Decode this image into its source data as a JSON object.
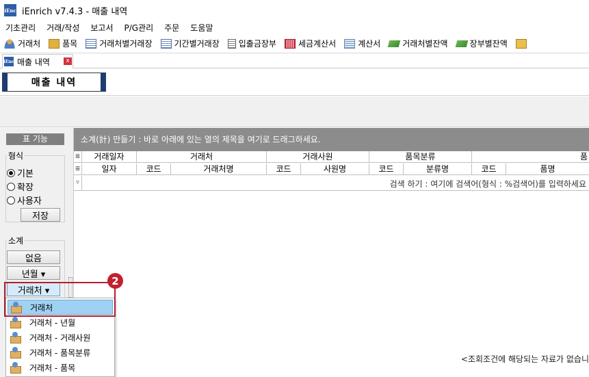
{
  "app": {
    "icon_text": "iEnc",
    "title": "iEnrich v7.4.3 - 매출 내역"
  },
  "menu": [
    "기초관리",
    "거래/작성",
    "보고서",
    "P/G관리",
    "주문",
    "도움말"
  ],
  "toolbar": [
    {
      "label": "거래처",
      "icon": "user-icon"
    },
    {
      "label": "품목",
      "icon": "box-icon"
    },
    {
      "label": "거래처별거래장",
      "icon": "list-icon"
    },
    {
      "label": "기간별거래장",
      "icon": "list-icon"
    },
    {
      "label": "입출금장부",
      "icon": "ledger-icon"
    },
    {
      "label": "세금계산서",
      "icon": "invoice-icon"
    },
    {
      "label": "계산서",
      "icon": "calc-icon"
    },
    {
      "label": "거래처별잔액",
      "icon": "money-icon"
    },
    {
      "label": "장부별잔액",
      "icon": "money-icon"
    }
  ],
  "tab": {
    "label": "매출 내역",
    "close": "x"
  },
  "banner": {
    "title": "매출 내역"
  },
  "left_panel": {
    "header": "표 기능",
    "format_group": "형식",
    "radios": [
      {
        "label": "기본",
        "checked": true
      },
      {
        "label": "확장",
        "checked": false
      },
      {
        "label": "사용자",
        "checked": false
      }
    ],
    "save_button": "저장",
    "subtotal_group": "소계",
    "btn_none": "없음",
    "btn_yearmonth": "년월 ▾",
    "btn_client": "거래처 ▾"
  },
  "grid": {
    "group_bar": "소계(計) 만들기 : 바로 아래에 있는 열의 제목을 여기로 드래그하세요.",
    "top_headers": [
      "거래일자",
      "거래처",
      "거래사원",
      "품목분류",
      "품"
    ],
    "sub_headers": [
      "일자",
      "코드",
      "거래처명",
      "코드",
      "사원명",
      "코드",
      "분류명",
      "코드",
      "품명"
    ],
    "filter_hint": "검색 하기 : 여기에 검색어(형식 : %검색어)를 입력하세요",
    "empty_message": "<조회조건에 해당되는 자료가 없습니"
  },
  "annotation": {
    "badge": "2"
  },
  "dropdown": {
    "items": [
      "거래처",
      "거래처 - 년월",
      "거래처 - 거래사원",
      "거래처 - 품목분류",
      "거래처 - 품목"
    ],
    "selected": 0
  },
  "colors": {
    "accent_red": "#c3202f",
    "selection_blue": "#9fd2f2",
    "banner_navy": "#1e3d6e"
  }
}
